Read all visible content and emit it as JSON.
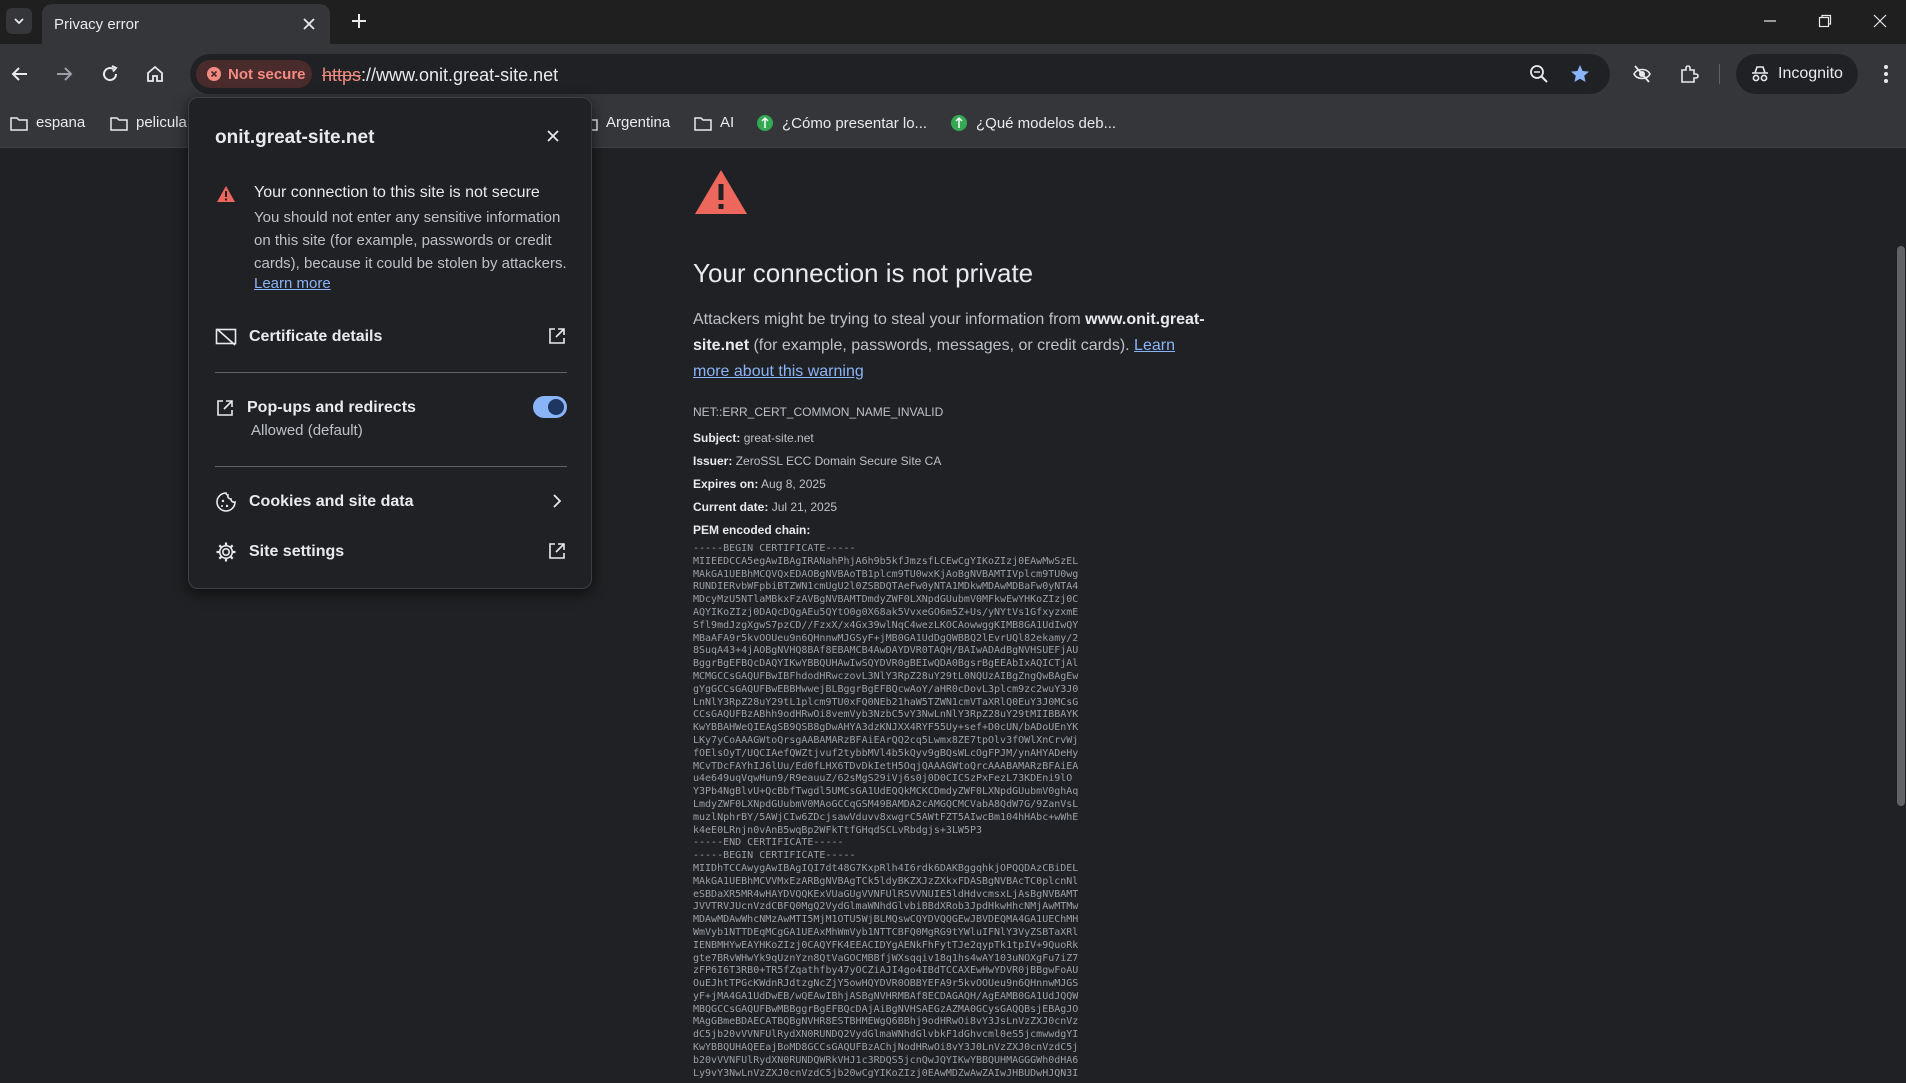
{
  "tab": {
    "title": "Privacy error"
  },
  "omnibox": {
    "security_chip": "Not secure",
    "url_scheme": "https",
    "url_rest": "://www.onit.great-site.net"
  },
  "profile": {
    "label": "Incognito"
  },
  "bookmarks": [
    {
      "type": "folder",
      "label": "espana"
    },
    {
      "type": "folder",
      "label": "pelicula"
    },
    {
      "type": "folder",
      "label": "Argentina"
    },
    {
      "type": "folder",
      "label": "AI"
    },
    {
      "type": "site",
      "label": "¿Cómo presentar lo..."
    },
    {
      "type": "site",
      "label": "¿Qué modelos deb..."
    }
  ],
  "popup": {
    "domain": "onit.great-site.net",
    "warning_title": "Your connection to this site is not secure",
    "warning_body": "You should not enter any sensitive information on this site (for example, passwords or credit cards), because it could be stolen by attackers.",
    "learn_more": "Learn more",
    "certificate": "Certificate details",
    "popups_label": "Pop-ups and redirects",
    "popups_sub": "Allowed (default)",
    "popups_enabled": true,
    "cookies": "Cookies and site data",
    "site_settings": "Site settings"
  },
  "error": {
    "title": "Your connection is not private",
    "desc_pre": "Attackers might be trying to steal your information from ",
    "desc_host": "www.onit.great-site.net",
    "desc_mid": " (for example, passwords, messages, or credit cards). ",
    "desc_link": "Learn more about this warning",
    "code": "NET::ERR_CERT_COMMON_NAME_INVALID",
    "subject_label": "Subject:",
    "subject": "great-site.net",
    "issuer_label": "Issuer:",
    "issuer": "ZeroSSL ECC Domain Secure Site CA",
    "expires_label": "Expires on:",
    "expires": "Aug 8, 2025",
    "current_label": "Current date:",
    "current": "Jul 21, 2025",
    "pem_label": "PEM encoded chain:",
    "pem": "-----BEGIN CERTIFICATE-----\nMIIEEDCCA5egAwIBAgIRANahPhjA6h9b5kfJmzsfLCEwCgYIKoZIzj0EAwMwSzEL\nMAkGA1UEBhMCQVQxEDAOBgNVBAoTB1plcm9TU0wxKjAoBgNVBAMTIVplcm9TU0wg\nRUNDIERvbWFpbiBTZWN1cmUgU2l0ZSBDQTAeFw0yNTA1MDkwMDAwMDBaFw0yNTA4\nMDcyMzU5NTlaMBkxFzAVBgNVBAMTDmdyZWF0LXNpdGUubmV0MFkwEwYHKoZIzj0C\nAQYIKoZIzj0DAQcDQgAEu5QYtO0g0X68ak5VvxeGO6m5Z+Us/yNYtVs1GfxyzxmE\nSfl9mdJzgXgwS7pzCD//FzxX/x4Gx39wlNqC4wezLKOCAowwggKIMB8GA1UdIwQY\nMBaAFA9r5kvOOUeu9n6QHnnwMJGSyF+jMB0GA1UdDgQWBBQ2lEvrUQl82ekamy/2\n8SuqA43+4jAOBgNVHQ8BAf8EBAMCB4AwDAYDVR0TAQH/BAIwADAdBgNVHSUEFjAU\nBggrBgEFBQcDAQYIKwYBBQUHAwIwSQYDVR0gBEIwQDA0BgsrBgEEAbIxAQICTjAl\nMCMGCCsGAQUFBwIBFhdodHRwczovL3NlY3RpZ28uY29tL0NQUzAIBgZngQwBAgEw\ngYgGCCsGAQUFBwEBBHwwejBLBggrBgEFBQcwAoY/aHR0cDovL3plcm9zc2wuY3J0\nLnNlY3RpZ28uY29tL1plcm9TU0xFQ0NEb21haW5TZWN1cmVTaXRlQ0EuY3J0MCsG\nCCsGAQUFBzABhh9odHRwOi8vemVyb3NzbC5vY3NwLnNlY3RpZ28uY29tMIIBBAYK\nKwYBBAHWeQIEAgSB9QSB8gDwAHYA3dzKNJXX4RYF55Uy+sef+D0cUN/bADoUEnYK\nLKy7yCoAAAGWtoQrsgAABAMARzBFAiEArQQ2cq5Lwmx8ZE7tpOlv3fOWlXnCrvWj\nfOElsOyT/UQCIAefQWZtjvuf2tybbMVl4b5kQyv9gBQsWLcOgFPJM/ynAHYADeHy\nMCvTDcFAYhIJ6lUu/Ed0fLHX6TDvDkIetH5OqjQAAAGWtoQrcAAABAMARzBFAiEA\nu4e649uqVqwHun9/R9eauuZ/62sMgS29iVj6s0j0D0CICSzPxFezL73KDEni9lO\nY3Pb4NgBlvU+QcBbfTwgdl5UMCsGA1UdEQQkMCKCDmdyZWF0LXNpdGUubmV0ghAq\nLmdyZWF0LXNpdGUubmV0MAoGCCqGSM49BAMDA2cAMGQCMCVabA8QdW7G/9ZanVsL\nmuzlNphrBY/5AWjCIw6ZDcjsawVduvv8xwgrC5AWtFZT5AIwcBm104hHAbc+wWhE\nk4eE0LRnjn0vAnB5wqBp2WFkTtfGHqdSCLvRbdgjs+3LW5P3\n-----END CERTIFICATE-----\n-----BEGIN CERTIFICATE-----\nMIIDhTCCAwygAwIBAgIQI7dt48G7KxpRlh4I6rdk6DAKBggqhkjOPQQDAzCBiDEL\nMAkGA1UEBhMCVVMxEzARBgNVBAgTCk5ldyBKZXJzZXkxFDASBgNVBAcTC0plcnNl\neSBDaXR5MR4wHAYDVQQKExVUaGUgVVNFUlRSVVNUIE5ldHdvcmsxLjAsBgNVBAMT\nJVVTRVJUcnVzdCBFQ0MgQ2VydGlmaWNhdGlvbiBBdXRob3JpdHkwHhcNMjAwMTMw\nMDAwMDAwWhcNMzAwMTI5MjM1OTU5WjBLMQswCQYDVQQGEwJBVDEQMA4GA1UEChMH\nWmVyb1NTTDEqMCgGA1UEAxMhWmVyb1NTTCBFQ0MgRG9tYWluIFNlY3VyZSBTaXRl\nIENBMHYwEAYHKoZIzj0CAQYFK4EEACIDYgAENkFhFytTJe2qypTk1tpIV+9QuoRk\ngte7BRvWHwYk9qUznYzn8QtVaGOCMBBfjWXsqqiv18q1hs4wAY103uNOXgFu7iZ7\nzFP6I6T3RB0+TR5fZqathfby47yOCZiAJI4go4IBdTCCAXEwHwYDVR0jBBgwFoAU\nOuEJhtTPGcKWdnRJdtzgNcZjY5owHQYDVR0OBBYEFA9r5kvOOUeu9n6QHnnwMJGS\nyF+jMA4GA1UdDwEB/wQEAwIBhjASBgNVHRMBAf8ECDAGAQH/AgEAMB0GA1UdJQQW\nMBQGCCsGAQUFBwMBBggrBgEFBQcDAjAiBgNVHSAEGzAZMA0GCysGAQQBsjEBAgJO\nMAgGBmeBDAECATBQBgNVHR8ESTBHMEWgQ6BBhj9odHRwOi8vY3JsLnVzZXJ0cnVz\ndC5jb20vVVNFUlRydXN0RUNDQ2VydGlmaWNhdGlvbkF1dGhvcml0eS5jcmwwdgYI\nKwYBBQUHAQEEajBoMD8GCCsGAQUFBzAChjNodHRwOi8vY3J0LnVzZXJ0cnVzdC5j\nb20vVVNFUlRydXN0RUNDQWRkVHJ1c3RDQS5jcnQwJQYIKwYBBQUHMAGGGWh0dHA6\nLy9vY3NwLnVzZXJ0cnVzdC5jb20wCgYIKoZIzj0EAwMDZwAwZAIwJHBUDwHJQN3I"
  }
}
